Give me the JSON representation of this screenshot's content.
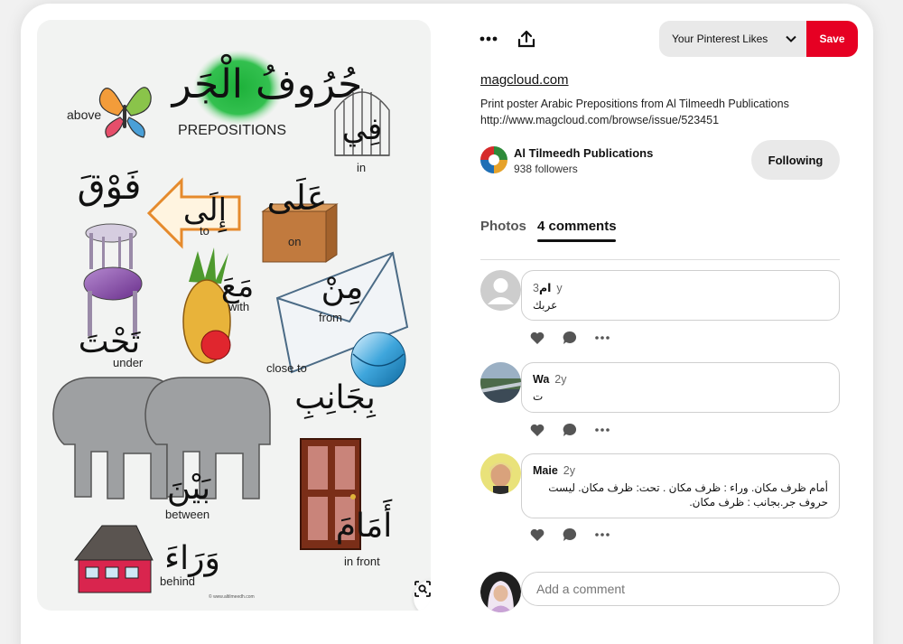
{
  "header": {
    "board_select_label": "Your Pinterest Likes",
    "save_label": "Save"
  },
  "pin": {
    "source_domain": "magcloud.com",
    "description": "Print poster Arabic Prepositions from Al Tilmeedh Publications http://www.magcloud.com/browse/issue/523451",
    "poster": {
      "title_ar": "حُرُوفُ الْجَر",
      "title_en": "PREPOSITIONS",
      "footer": "© www.altilmeedh.com",
      "words": [
        {
          "ar": "فِي",
          "en": "in"
        },
        {
          "ar": "فَوْقَ",
          "en": "above"
        },
        {
          "ar": "إِلَى",
          "en": "to"
        },
        {
          "ar": "عَلَى",
          "en": "on"
        },
        {
          "ar": "مَعَ",
          "en": "with"
        },
        {
          "ar": "مِنْ",
          "en": "from"
        },
        {
          "ar": "تَحْتَ",
          "en": "under"
        },
        {
          "ar": "بِجَانِبِ",
          "en": "close to"
        },
        {
          "ar": "بَيْنَ",
          "en": "between"
        },
        {
          "ar": "أَمَامَ",
          "en": "in front"
        },
        {
          "ar": "وَرَاءَ",
          "en": "behind"
        }
      ]
    }
  },
  "creator": {
    "name": "Al Tilmeedh Publications",
    "followers": "938 followers",
    "follow_label": "Following"
  },
  "tabs": [
    {
      "label": "Photos",
      "active": false
    },
    {
      "label": "4 comments",
      "active": true
    }
  ],
  "comments": [
    {
      "author": "ام",
      "time": "3y",
      "text": "عربك",
      "rtl": true
    },
    {
      "author": "Wa",
      "time": "2y",
      "text": "ت",
      "rtl": false
    },
    {
      "author": "Maie",
      "time": "2y",
      "text": "أمام ظرف مكان. وراء : ظرف مكان . تحت: ظرف مكان. ليست حروف جر.بجانب : ظرف مكان.",
      "rtl": true
    }
  ],
  "add_comment": {
    "placeholder": "Add a comment"
  },
  "colors": {
    "save_red": "#e60023",
    "pill_gray": "#e9e9e9"
  },
  "icons": [
    "more-icon",
    "share-icon",
    "chevron-down-icon",
    "heart-icon",
    "comment-icon",
    "visual-search-icon"
  ]
}
